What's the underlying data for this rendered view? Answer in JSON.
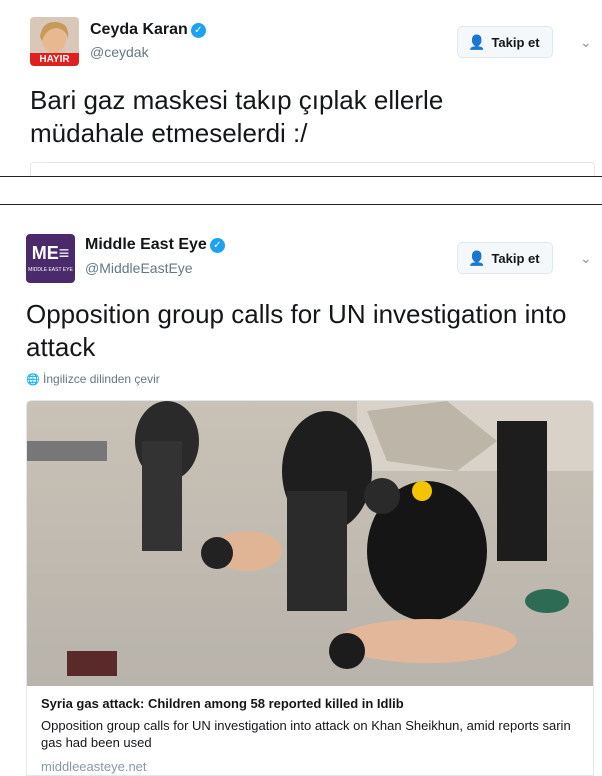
{
  "tweet1": {
    "author_name": "Ceyda Karan",
    "author_handle": "@ceydak",
    "avatar_badge": "HAYIR",
    "follow_label": "Takip et",
    "text": "Bari gaz maskesi takıp çıplak ellerle müdahale etmeselerdi :/"
  },
  "tweet2": {
    "author_name": "Middle East Eye",
    "author_handle": "@MiddleEastEye",
    "avatar_logo": "ME≡",
    "avatar_logo_sub": "MIDDLE EAST EYE",
    "follow_label": "Takip et",
    "text": "Opposition group calls for UN investigation into attack",
    "translate_label": "İngilizce dilinden çevir",
    "card": {
      "title": "Syria gas attack: Children among 58 reported killed in Idlib",
      "description": "Opposition group calls for UN investigation into attack on Khan Sheikhun, amid reports sarin gas had been used",
      "domain": "middleeasteye.net"
    }
  },
  "colors": {
    "accent": "#1da1f2",
    "text": "#14171a",
    "muted": "#657786",
    "border": "#e1e8ed",
    "brand_mee": "#4a2a6a"
  },
  "icons": {
    "verified": "verified-badge-icon",
    "follow": "follow-user-icon",
    "chevron": "chevron-down-icon",
    "globe": "globe-icon"
  }
}
